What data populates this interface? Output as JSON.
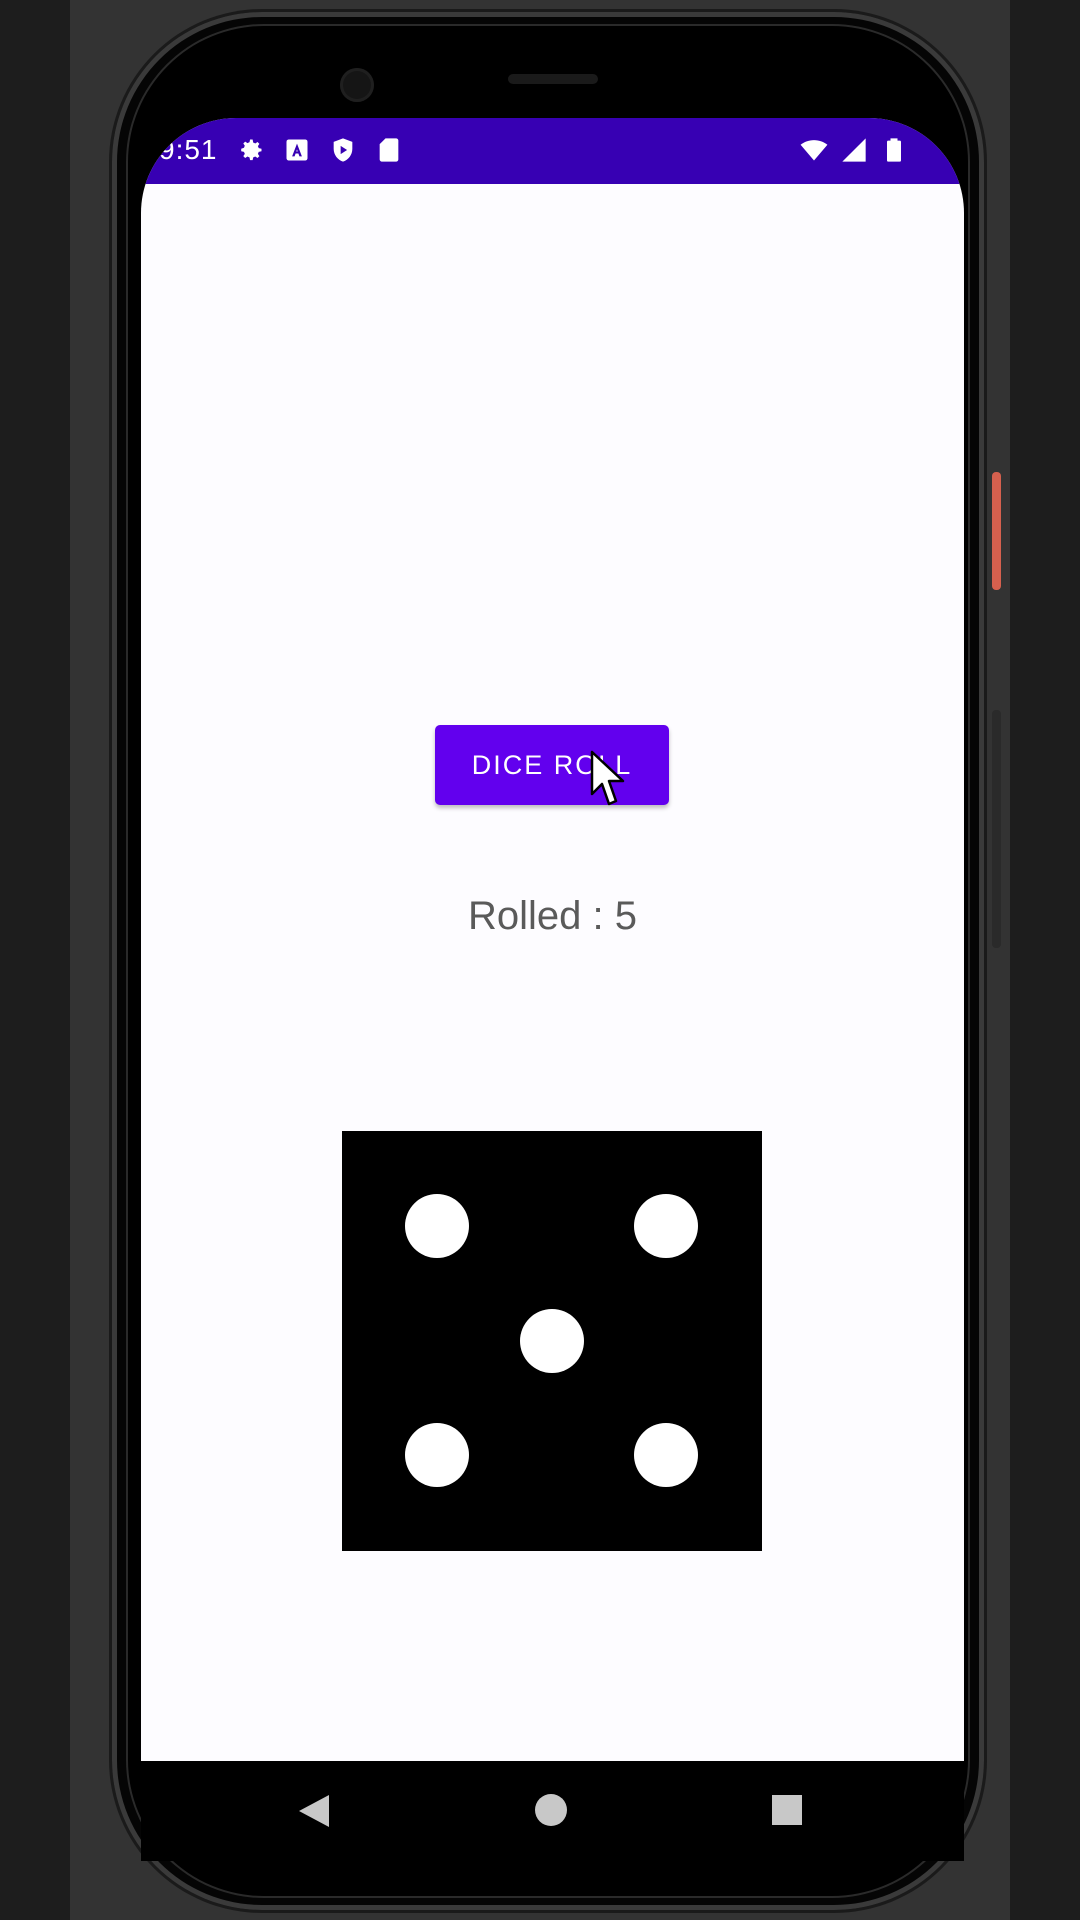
{
  "status_bar": {
    "time": "9:51",
    "left_icons": [
      "gear-icon",
      "a-icon",
      "shield-icon",
      "sd-card-icon"
    ],
    "right_icons": [
      "wifi-icon",
      "signal-icon",
      "battery-icon"
    ],
    "color": "#3700b3"
  },
  "main": {
    "roll_button_label": "DICE ROLL",
    "result_text": "Rolled : 5",
    "die_value": 5,
    "accent_color": "#6200ee"
  },
  "nav_bar": {
    "buttons": [
      "back-icon",
      "home-icon",
      "recents-icon"
    ]
  }
}
